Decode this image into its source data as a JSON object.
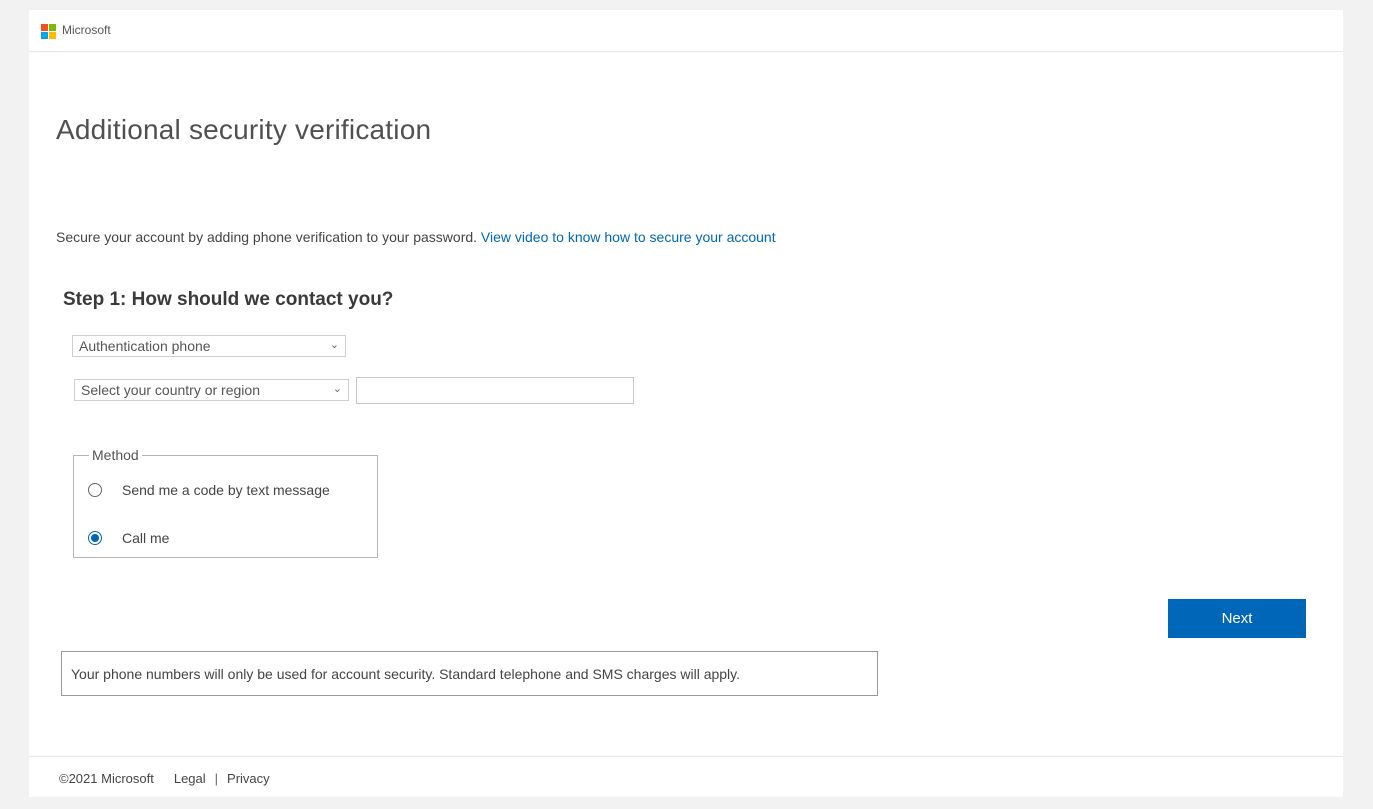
{
  "header": {
    "brand_name": "Microsoft",
    "logo_colors": [
      "#f25022",
      "#7fba00",
      "#00a4ef",
      "#ffb900"
    ]
  },
  "main": {
    "title": "Additional security verification",
    "intro_text": "Secure your account by adding phone verification to your password.",
    "intro_link": "View video to know how to secure your account",
    "step_heading": "Step 1: How should we contact you?",
    "contact_type_select": {
      "selected": "Authentication phone"
    },
    "country_select": {
      "selected": "Select your country or region"
    },
    "phone_input": {
      "value": ""
    },
    "method": {
      "legend": "Method",
      "options": [
        {
          "label": "Send me a code by text message",
          "selected": false
        },
        {
          "label": "Call me",
          "selected": true
        }
      ]
    },
    "next_button": "Next",
    "notice": "Your phone numbers will only be used for account security. Standard telephone and SMS charges will apply."
  },
  "footer": {
    "copyright": "©2021 Microsoft",
    "legal": "Legal",
    "separator": "|",
    "privacy": "Privacy"
  },
  "colors": {
    "accent": "#0067b8",
    "background": "#f2f2f2"
  }
}
